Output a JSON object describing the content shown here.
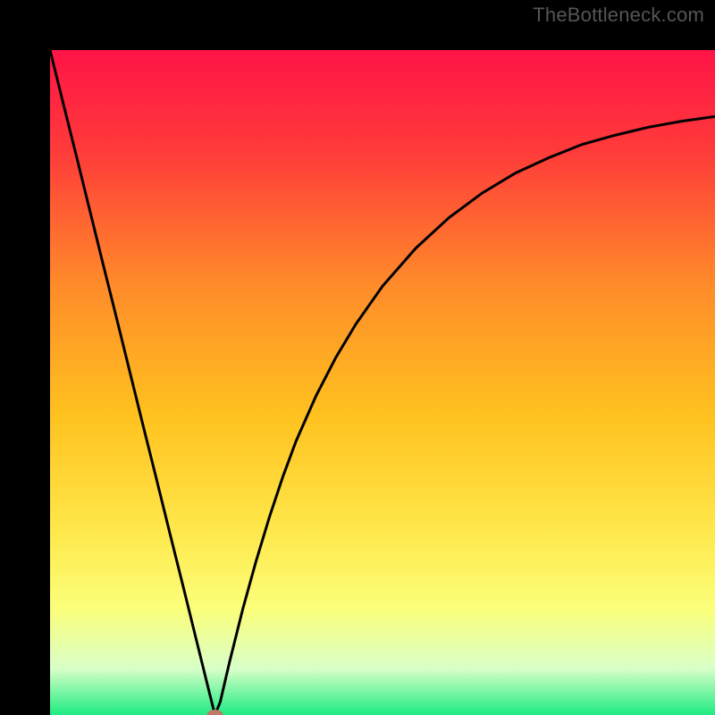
{
  "watermark": "TheBottleneck.com",
  "chart_data": {
    "type": "line",
    "title": "",
    "xlabel": "",
    "ylabel": "",
    "xlim": [
      0,
      1
    ],
    "ylim": [
      0,
      1
    ],
    "background_gradient": {
      "stops": [
        {
          "offset": 0.0,
          "color": "#ff1447"
        },
        {
          "offset": 0.15,
          "color": "#ff3a3a"
        },
        {
          "offset": 0.35,
          "color": "#ff8a2a"
        },
        {
          "offset": 0.55,
          "color": "#ffc21f"
        },
        {
          "offset": 0.72,
          "color": "#ffe74a"
        },
        {
          "offset": 0.84,
          "color": "#fbff7a"
        },
        {
          "offset": 0.93,
          "color": "#d9ffc8"
        },
        {
          "offset": 1.0,
          "color": "#1eeb82"
        }
      ]
    },
    "series": [
      {
        "name": "bottleneck-curve",
        "color": "#000000",
        "width": 3,
        "x": [
          0.0,
          0.02,
          0.04,
          0.06,
          0.08,
          0.1,
          0.12,
          0.14,
          0.16,
          0.18,
          0.2,
          0.22,
          0.24,
          0.248,
          0.256,
          0.27,
          0.29,
          0.31,
          0.33,
          0.35,
          0.37,
          0.4,
          0.43,
          0.46,
          0.5,
          0.55,
          0.6,
          0.65,
          0.7,
          0.75,
          0.8,
          0.85,
          0.9,
          0.95,
          1.0
        ],
        "y": [
          1.0,
          0.919,
          0.839,
          0.758,
          0.677,
          0.597,
          0.516,
          0.435,
          0.355,
          0.274,
          0.194,
          0.113,
          0.032,
          0.0,
          0.02,
          0.08,
          0.16,
          0.232,
          0.298,
          0.358,
          0.412,
          0.48,
          0.538,
          0.588,
          0.645,
          0.702,
          0.748,
          0.785,
          0.815,
          0.838,
          0.858,
          0.872,
          0.884,
          0.893,
          0.9
        ]
      }
    ],
    "marker": {
      "name": "min-point",
      "x": 0.248,
      "y": 0.0,
      "rx": 9,
      "ry": 6,
      "fill": "#c07a6a"
    }
  }
}
